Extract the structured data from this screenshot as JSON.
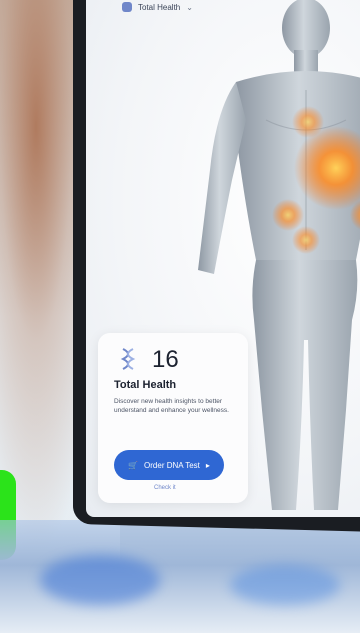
{
  "header": {
    "title": "Total Health"
  },
  "card": {
    "count": "16",
    "title": "Total Health",
    "description": "Discover new health insights to better understand and enhance your wellness.",
    "button_label": "Order DNA Test",
    "link_label": "Check it"
  },
  "icons": {
    "header_dna": "dna-icon",
    "card_dna": "dna-icon",
    "dropdown": "chevron-down-icon",
    "cart": "cart-icon",
    "arrow": "arrow-right-icon"
  },
  "colors": {
    "accent": "#2f67d3",
    "card_bg": "#fcfcfd",
    "text_dark": "#1c2230",
    "text_muted": "#4d5566",
    "body_glow": "#ff8a1f"
  }
}
